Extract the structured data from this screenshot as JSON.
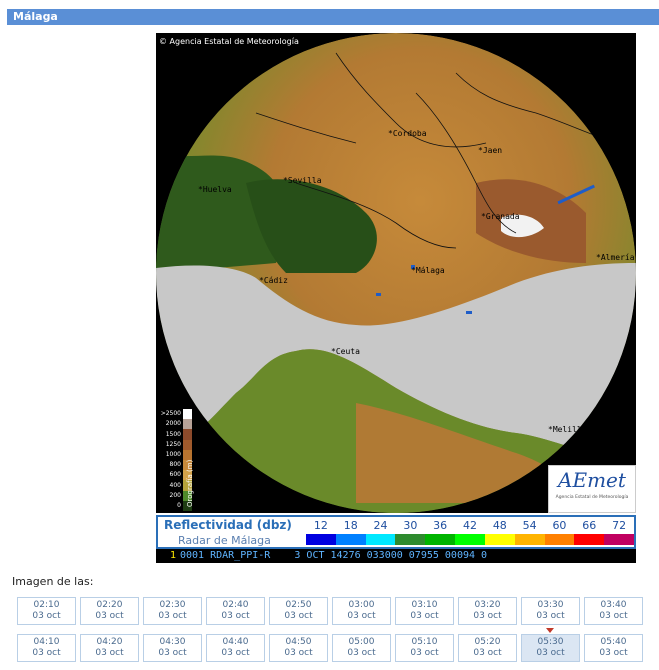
{
  "header": {
    "title": "Málaga"
  },
  "radar": {
    "copyright": "Agencia Estatal de Meteorología",
    "copyright_symbol": "©",
    "logo_text": "AEmet",
    "logo_sub": "Agencia Estatal de Meteorología",
    "cities": [
      {
        "name": "Cordoba"
      },
      {
        "name": "Jaen"
      },
      {
        "name": "Huelva"
      },
      {
        "name": "Sevilla"
      },
      {
        "name": "Granada"
      },
      {
        "name": "Málaga"
      },
      {
        "name": "Ceuta"
      },
      {
        "name": "Melilla"
      },
      {
        "name": "Almería"
      },
      {
        "name": "Cádiz"
      }
    ],
    "oro_label": "Orografía (m)",
    "oro_ticks": [
      ">2500",
      "2000",
      "1500",
      "1250",
      "1000",
      "800",
      "600",
      "400",
      "200",
      "0"
    ],
    "oro_colors": [
      "#ffffff",
      "#b8a398",
      "#8c4a2b",
      "#a05a2c",
      "#b8742f",
      "#c98a3a",
      "#d4a24a",
      "#b5a33a",
      "#4f8a2a",
      "#1e3d12"
    ],
    "legend_title": "Reflectividad (dbz)",
    "legend_sub": "Radar de Málaga",
    "dbz_values": [
      "12",
      "18",
      "24",
      "30",
      "36",
      "42",
      "48",
      "54",
      "60",
      "66",
      "72"
    ],
    "dbz_colors": [
      "#0000e0",
      "#0080ff",
      "#00e8ff",
      "#2e8b2e",
      "#00b400",
      "#00ff00",
      "#ffff00",
      "#ffb400",
      "#ff8000",
      "#ff0000",
      "#c00060"
    ],
    "info_line": "0001 RDAR_PPI-R    3 OCT 14276 033000 07955 00094 0"
  },
  "imagen": {
    "label": "Imagen de las:"
  },
  "times": {
    "row1": [
      {
        "time": "02:10",
        "date": "03 oct"
      },
      {
        "time": "02:20",
        "date": "03 oct"
      },
      {
        "time": "02:30",
        "date": "03 oct"
      },
      {
        "time": "02:40",
        "date": "03 oct"
      },
      {
        "time": "02:50",
        "date": "03 oct"
      },
      {
        "time": "03:00",
        "date": "03 oct"
      },
      {
        "time": "03:10",
        "date": "03 oct"
      },
      {
        "time": "03:20",
        "date": "03 oct"
      },
      {
        "time": "03:30",
        "date": "03 oct"
      },
      {
        "time": "03:40",
        "date": "03 oct"
      }
    ],
    "row2": [
      {
        "time": "04:10",
        "date": "03 oct"
      },
      {
        "time": "04:20",
        "date": "03 oct"
      },
      {
        "time": "04:30",
        "date": "03 oct"
      },
      {
        "time": "04:40",
        "date": "03 oct"
      },
      {
        "time": "04:50",
        "date": "03 oct"
      },
      {
        "time": "05:00",
        "date": "03 oct"
      },
      {
        "time": "05:10",
        "date": "03 oct"
      },
      {
        "time": "05:20",
        "date": "03 oct"
      },
      {
        "time": "05:30",
        "date": "03 oct"
      },
      {
        "time": "05:40",
        "date": "03 oct"
      }
    ],
    "selected": "05:30"
  }
}
